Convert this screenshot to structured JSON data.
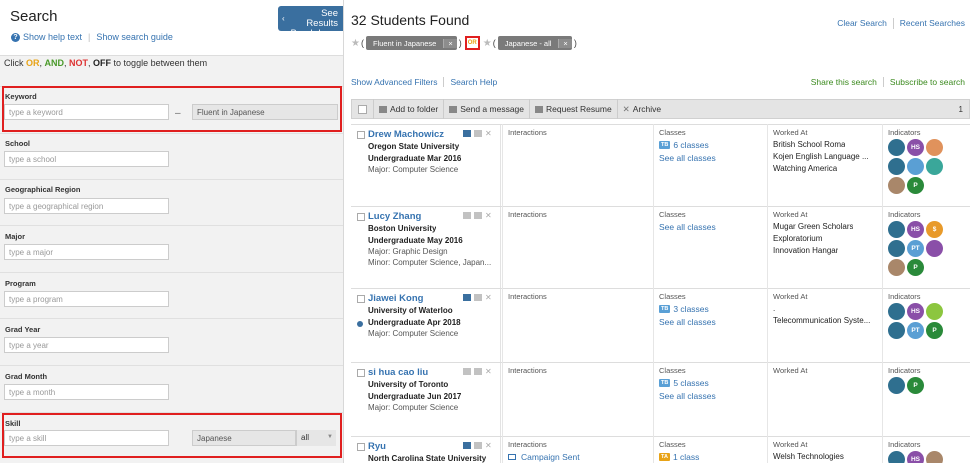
{
  "sidebar": {
    "title": "Search",
    "help_link": "Show help text",
    "guide_link": "Show search guide",
    "see_results": [
      "See Results",
      "Breakdown"
    ],
    "toggle_hint": {
      "prefix": "Click ",
      "or": "OR",
      "and": "AND",
      "not": "NOT",
      "off": "OFF",
      "suffix": " to toggle between them"
    },
    "fields": [
      {
        "label": "Keyword",
        "placeholder": "type a keyword",
        "value": "Fluent in Japanese"
      },
      {
        "label": "School",
        "placeholder": "type a school"
      },
      {
        "label": "Geographical Region",
        "placeholder": "type a geographical region"
      },
      {
        "label": "Major",
        "placeholder": "type a major"
      },
      {
        "label": "Program",
        "placeholder": "type a program"
      },
      {
        "label": "Grad Year",
        "placeholder": "type a year"
      },
      {
        "label": "Grad Month",
        "placeholder": "type a month"
      },
      {
        "label": "Skill",
        "placeholder": "type a skill",
        "value": "Japanese",
        "select": "all"
      }
    ]
  },
  "main": {
    "title": "32 Students Found",
    "clear_search": "Clear Search",
    "recent_searches": "Recent Searches",
    "chips": [
      {
        "label": "Fluent in Japanese"
      },
      {
        "label": "Japanese - all"
      }
    ],
    "or_label": "OR",
    "advanced": "Show Advanced Filters",
    "search_help": "Search Help",
    "share": "Share this search",
    "subscribe": "Subscribe to search",
    "toolbar": {
      "add": "Add to folder",
      "message": "Send a message",
      "resume": "Request Resume",
      "archive": "Archive",
      "count": "1"
    },
    "col_headers": {
      "interactions": "Interactions",
      "classes": "Classes",
      "worked_at": "Worked At",
      "indicators": "Indicators"
    },
    "students": [
      {
        "name": "Drew Machowicz",
        "school": "Oregon State University",
        "grad": "Undergraduate Mar 2016",
        "major": "Major: Computer Science",
        "minor": "",
        "interaction": "",
        "tag": "TB",
        "classes": "6 classes",
        "see_all": "See all classes",
        "work": [
          "British School Roma",
          "Kojen English Language ...",
          "Watching America"
        ]
      },
      {
        "name": "Lucy Zhang",
        "school": "Boston University",
        "grad": "Undergraduate May 2016",
        "major": "Major: Graphic Design",
        "minor": "Minor: Computer Science, Japan...",
        "interaction": "",
        "tag": "",
        "classes": "",
        "see_all": "See all classes",
        "work": [
          "Mugar Green Scholars",
          "Exploratorium",
          "Innovation Hangar"
        ]
      },
      {
        "name": "Jiawei Kong",
        "school": "University of Waterloo",
        "grad": "Undergraduate Apr 2018",
        "major": "Major: Computer Science",
        "minor": "",
        "interaction": "",
        "tag": "TB",
        "classes": "3 classes",
        "see_all": "See all classes",
        "work": [
          ".",
          "Telecommunication Syste..."
        ]
      },
      {
        "name": "si hua cao liu",
        "school": "University of Toronto",
        "grad": "Undergraduate Jun 2017",
        "major": "Major: Computer Science",
        "minor": "",
        "interaction": "",
        "tag": "TB",
        "classes": "5 classes",
        "see_all": "See all classes",
        "work": []
      },
      {
        "name": "Ryu",
        "school": "North Carolina State University",
        "grad": "",
        "major": "",
        "minor": "",
        "interaction": "Campaign Sent",
        "tag": "TA",
        "classes": "1 class",
        "see_all": "",
        "work": [
          "Welsh Technologies"
        ]
      }
    ],
    "badges": [
      [
        {
          "t": "",
          "c": "#2f6f8f"
        },
        {
          "t": "HS",
          "c": "#8a4fa8"
        },
        {
          "t": "",
          "c": "#e0925c"
        },
        {
          "t": "",
          "c": "#2f6f8f"
        },
        {
          "t": "",
          "c": "#5a9fd4"
        },
        {
          "t": "",
          "c": "#3aa79a"
        },
        {
          "t": "",
          "c": "#a9876a"
        },
        {
          "t": "P",
          "c": "#2a8a3a"
        }
      ],
      [
        {
          "t": "",
          "c": "#2f6f8f"
        },
        {
          "t": "HS",
          "c": "#8a4fa8"
        },
        {
          "t": "$",
          "c": "#e89a2a"
        },
        {
          "t": "",
          "c": "#2f6f8f"
        },
        {
          "t": "PT",
          "c": "#5a9fd4"
        },
        {
          "t": "",
          "c": "#8a4fa8"
        },
        {
          "t": "",
          "c": "#a9876a"
        },
        {
          "t": "P",
          "c": "#2a8a3a"
        }
      ],
      [
        {
          "t": "",
          "c": "#2f6f8f"
        },
        {
          "t": "HS",
          "c": "#8a4fa8"
        },
        {
          "t": "",
          "c": "#8cc63f"
        },
        {
          "t": "",
          "c": "#2f6f8f"
        },
        {
          "t": "PT",
          "c": "#5a9fd4"
        },
        {
          "t": "P",
          "c": "#2a8a3a"
        }
      ],
      [
        {
          "t": "",
          "c": "#2f6f8f"
        },
        {
          "t": "P",
          "c": "#2a8a3a"
        }
      ],
      [
        {
          "t": "",
          "c": "#2f6f8f"
        },
        {
          "t": "HS",
          "c": "#8a4fa8"
        },
        {
          "t": "",
          "c": "#a9876a"
        }
      ]
    ]
  }
}
